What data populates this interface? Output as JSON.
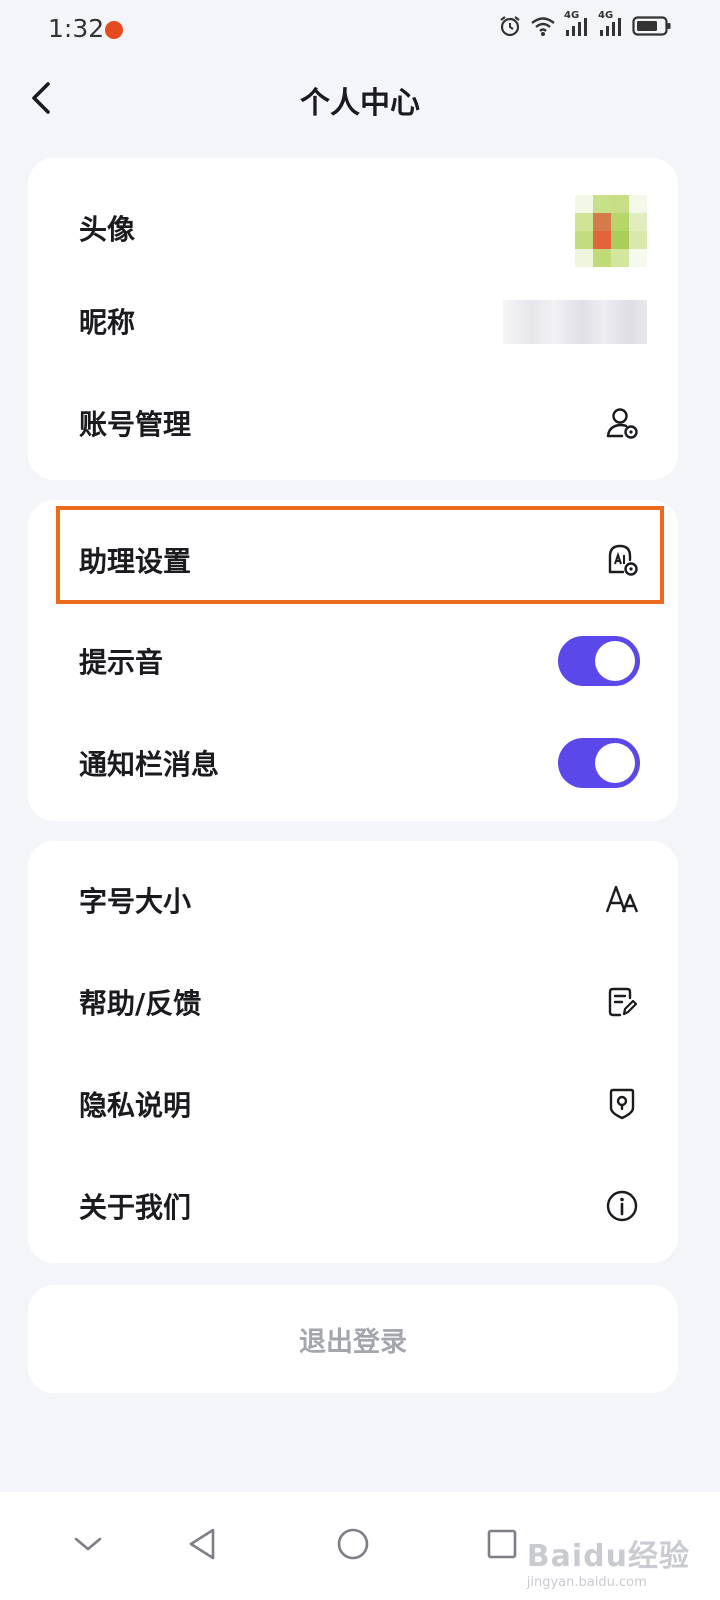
{
  "status_bar": {
    "time": "1:32",
    "network_label_1": "4G",
    "network_label_2": "4G"
  },
  "header": {
    "title": "个人中心",
    "back_icon": "chevron-left-icon"
  },
  "account_section": {
    "avatar_label": "头像",
    "nickname_label": "昵称",
    "account_manage_label": "账号管理",
    "account_manage_icon": "user-settings-icon"
  },
  "assistant_section": {
    "assistant_settings_label": "助理设置",
    "assistant_settings_icon": "assistant-settings-icon",
    "sound_label": "提示音",
    "sound_enabled": true,
    "notification_label": "通知栏消息",
    "notification_enabled": true
  },
  "general_section": {
    "font_size_label": "字号大小",
    "font_size_icon": "font-size-icon",
    "help_label": "帮助/反馈",
    "help_icon": "feedback-icon",
    "privacy_label": "隐私说明",
    "privacy_icon": "shield-icon",
    "about_label": "关于我们",
    "about_icon": "info-icon"
  },
  "logout": {
    "label": "退出登录"
  },
  "watermark": {
    "main": "Baidu经验",
    "sub": "jingyan.baidu.com"
  },
  "colors": {
    "accent": "#5b48ea",
    "highlight": "#ec6a1c",
    "background": "#f4f5f9",
    "logout_text": "#a4a6ae"
  }
}
